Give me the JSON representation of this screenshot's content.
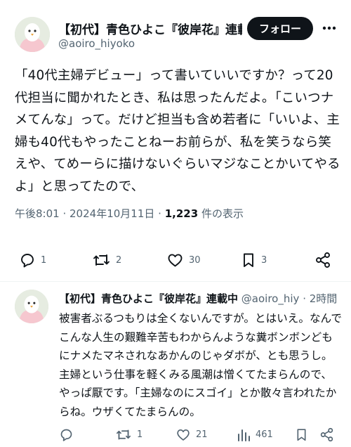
{
  "tweet": {
    "author_name": "【初代】青色ひよこ『彼岸花』連載中",
    "author_handle": "@aoiro_hiyoko",
    "follow_label": "フォロー",
    "body": "「40代主婦デビュー」って書いていいですか？って20代担当に聞かれたとき、私は思ったんだよ。「こいつナメてんな」って。だけど担当も含め若者に「いいよ、主婦も40代もやったことねーお前らが、私を笑うなら笑えや、てめーらに描けないぐらいマジなことかいてやるよ」と思ってたので、",
    "time": "午後8:01",
    "date": "2024年10月11日",
    "views_count": "1,223",
    "views_label": "件の表示",
    "actions": {
      "replies": "1",
      "retweets": "2",
      "likes": "30",
      "bookmarks": "3"
    }
  },
  "reply": {
    "author_name": "【初代】青色ひよこ『彼岸花』連載中",
    "author_handle": "@aoiro_hiy",
    "separator": "·",
    "time": "2時間",
    "body": "被害者ぶるつもりは全くないんですが。とはいえ。なんでこんな人生の艱難辛苦もわからんような糞ボンボンどもにナメたマネされなあかんのじゃダボが、とも思うし。主婦という仕事を軽くみる風潮は憎くてたまらんので、やっぱ厭です。「主婦なのにスゴイ」とか散々言われたからね。ウザくてたまらんの。",
    "actions": {
      "retweets": "1",
      "likes": "21",
      "views": "461"
    }
  },
  "icons": [
    "more-icon",
    "reply-icon",
    "retweet-icon",
    "like-icon",
    "bookmark-icon",
    "share-icon",
    "views-icon"
  ],
  "colors": {
    "text": "#0f1419",
    "secondary": "#536471",
    "button": "#0f1419",
    "divider": "#eff3f4"
  }
}
